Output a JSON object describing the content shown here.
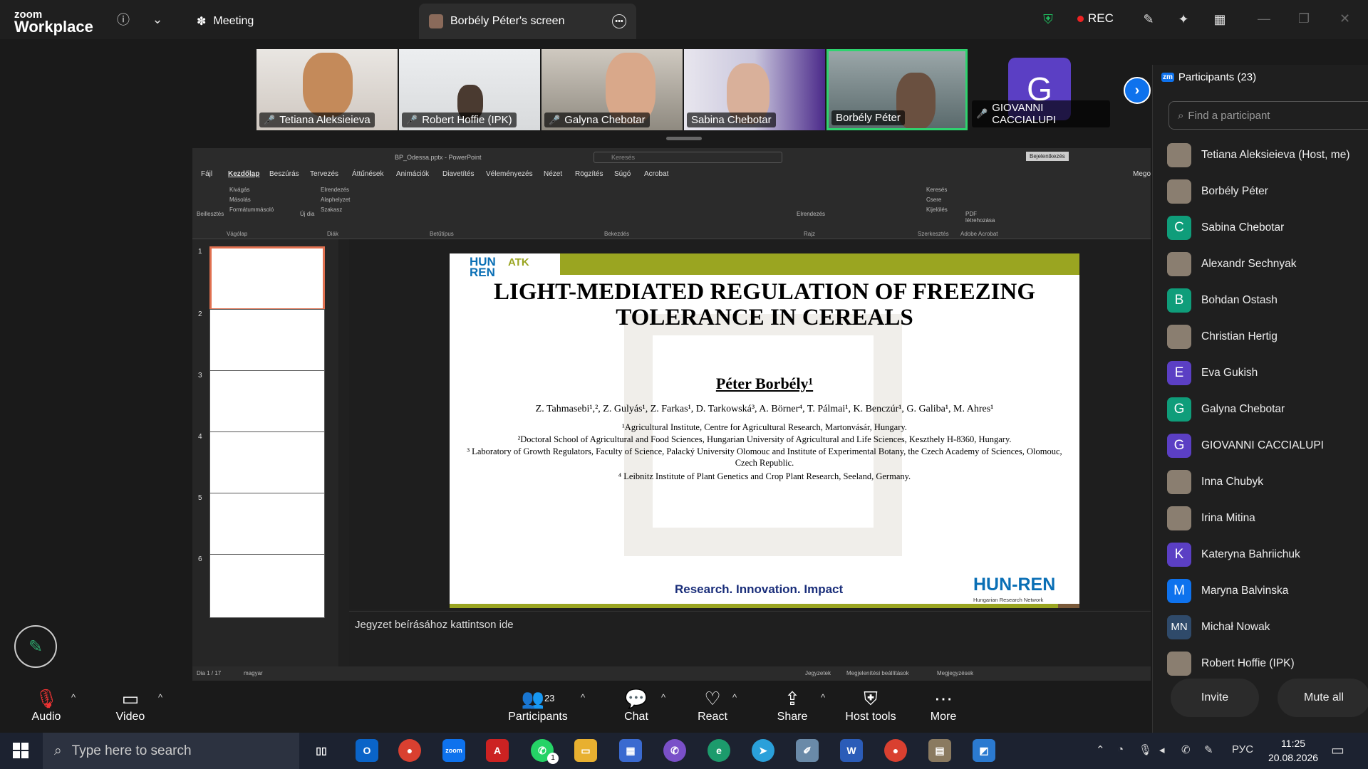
{
  "app": {
    "brand_top": "zoom",
    "brand_bottom": "Workplace"
  },
  "topbar": {
    "meeting_tab": "Meeting",
    "screen_tab": "Borbély Péter's screen",
    "rec_label": "REC"
  },
  "video_strip": [
    {
      "name": "Tetiana Aleksieieva",
      "muted": true
    },
    {
      "name": "Robert Hoffie (IPK)",
      "muted": true
    },
    {
      "name": "Galyna Chebotar",
      "muted": true
    },
    {
      "name": "Sabina Chebotar",
      "muted": false
    },
    {
      "name": "Borbély Péter",
      "muted": false,
      "active_speaker": true
    },
    {
      "name": "GIOVANNI CACCIALUPI",
      "muted": true,
      "initial": "G"
    }
  ],
  "ppt": {
    "file_title": "BP_Odessa.pptx - PowerPoint",
    "search_placeholder": "Keresés",
    "signin": "Bejelentkezés",
    "menus": [
      "Fájl",
      "Kezdőlap",
      "Beszúrás",
      "Tervezés",
      "Áttűnések",
      "Animációk",
      "Diavetítés",
      "Véleményezés",
      "Nézet",
      "Rögzítés",
      "Súgó",
      "Acrobat"
    ],
    "share_label": "Megosztás",
    "ribbon_groups": [
      "Vágólap",
      "Diák",
      "Betűtípus",
      "Bekezdés",
      "Rajz",
      "Szerkesztés",
      "Adobe Acrobat"
    ],
    "ribbon_items": {
      "paste": "Beillesztés",
      "cut": "Kivágás",
      "copy": "Másolás",
      "format_painter": "Formátummásoló",
      "new_slide": "Új dia",
      "layout": "Elrendezés",
      "reset": "Alaphelyzet",
      "section": "Szakasz",
      "arrange": "Elrendezés",
      "find": "Keresés",
      "replace": "Csere",
      "select": "Kijelölés",
      "pdf": "PDF létrehozása"
    },
    "thumbnails": [
      "1",
      "2",
      "3",
      "4",
      "5",
      "6"
    ],
    "notes_placeholder": "Jegyzet beírásához kattintson ide",
    "status": {
      "slide": "Dia 1 / 17",
      "language": "magyar",
      "notes": "Jegyzetek",
      "display": "Megjelenítési beállítások",
      "comments": "Megjegyzések"
    }
  },
  "slide": {
    "logo_text": "HUN REN",
    "atk_text": "ATK",
    "title": "LIGHT-MEDIATED REGULATION OF FREEZING TOLERANCE IN CEREALS",
    "presenter": "Péter Borbély¹",
    "coauthors": "Z. Tahmasebi¹,², Z. Gulyás¹, Z. Farkas¹, D. Tarkowská³, A. Börner⁴, T. Pálmai¹, K. Benczúr¹, G. Galiba¹, M. Ahres¹",
    "affiliations": [
      "¹Agricultural Institute, Centre for Agricultural Research, Martonvásár, Hungary.",
      "²Doctoral School of Agricultural and Food Sciences, Hungarian University of Agricultural and Life Sciences, Keszthely H-8360, Hungary.",
      "³ Laboratory of Growth Regulators, Faculty of Science, Palacký University Olomouc and Institute of Experimental Botany, the Czech Academy of Sciences, Olomouc, Czech Republic.",
      "⁴ Leibnitz Institute of Plant Genetics and Crop Plant Research, Seeland, Germany."
    ],
    "tagline": "Research. Innovation. Impact",
    "footer_logo": "HUN-REN",
    "footer_logo_sub": "Hungarian Research Network"
  },
  "participants_panel": {
    "title": "Participants (23)",
    "search_placeholder": "Find a participant",
    "list": [
      {
        "name": "Tetiana Aleksieieva (Host, me)",
        "initial": "",
        "color": "photo"
      },
      {
        "name": "Borbély Péter",
        "initial": "",
        "color": "photo"
      },
      {
        "name": "Sabina Chebotar",
        "initial": "C",
        "color": "#0f9d7a"
      },
      {
        "name": "Alexandr Sechnyak",
        "initial": "",
        "color": "photo"
      },
      {
        "name": "Bohdan Ostash",
        "initial": "B",
        "color": "#0f9d7a"
      },
      {
        "name": "Christian Hertig",
        "initial": "",
        "color": "photo"
      },
      {
        "name": "Eva Gukish",
        "initial": "E",
        "color": "#5b3fc4"
      },
      {
        "name": "Galyna Chebotar",
        "initial": "G",
        "color": "#0f9d7a"
      },
      {
        "name": "GIOVANNI CACCIALUPI",
        "initial": "G",
        "color": "#5b3fc4"
      },
      {
        "name": "Inna Chubyk",
        "initial": "",
        "color": "photo"
      },
      {
        "name": "Irina Mitina",
        "initial": "",
        "color": "photo"
      },
      {
        "name": "Kateryna Bahriichuk",
        "initial": "K",
        "color": "#5b3fc4"
      },
      {
        "name": "Maryna Balvinska",
        "initial": "M",
        "color": "#0e72ed"
      },
      {
        "name": "Michał Nowak",
        "initial": "MN",
        "color": "#2f4a6a"
      },
      {
        "name": "Robert Hoffie (IPK)",
        "initial": "",
        "color": "photo"
      }
    ],
    "invite_label": "Invite",
    "mute_all_label": "Mute all"
  },
  "controls": {
    "audio": "Audio",
    "video": "Video",
    "participants": "Participants",
    "participants_count": "23",
    "chat": "Chat",
    "react": "React",
    "share": "Share",
    "host_tools": "Host tools",
    "more": "More"
  },
  "taskbar": {
    "search_placeholder": "Type here to search",
    "language": "РУС",
    "time": "11:25",
    "date": "20.08.2026",
    "whatsapp_badge": "1"
  }
}
